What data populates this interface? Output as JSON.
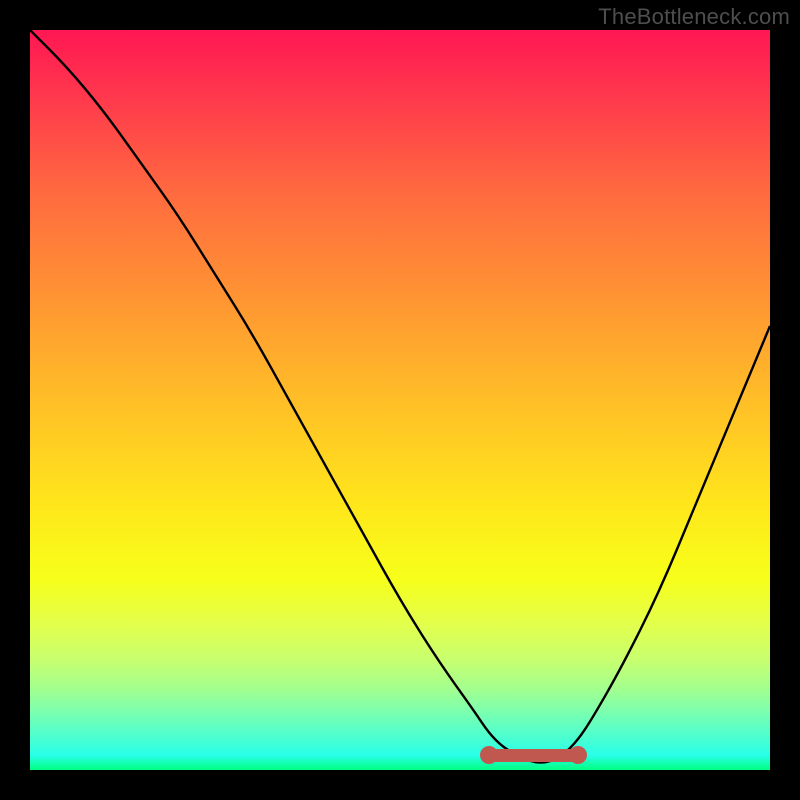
{
  "watermark": "TheBottleneck.com",
  "colors": {
    "frame_bg": "#000000",
    "curve_stroke": "#000000",
    "marker_fill": "#c1584f",
    "gradient_top": "#ff1753",
    "gradient_bottom": "#00ff80"
  },
  "chart_data": {
    "type": "line",
    "title": "",
    "xlabel": "",
    "ylabel": "",
    "xlim": [
      0,
      100
    ],
    "ylim": [
      0,
      100
    ],
    "x": [
      0,
      5,
      10,
      15,
      20,
      25,
      30,
      35,
      40,
      45,
      50,
      55,
      60,
      62,
      64,
      66,
      68,
      70,
      72,
      74,
      76,
      80,
      85,
      90,
      95,
      100
    ],
    "values": [
      100,
      95,
      89,
      82,
      75,
      67,
      59,
      50,
      41,
      32,
      23,
      15,
      8,
      5,
      3,
      2,
      1,
      1,
      2,
      4,
      7,
      14,
      24,
      36,
      48,
      60
    ],
    "trough": {
      "x_start": 62,
      "x_end": 74,
      "y": 2
    },
    "note": "Values are percentage heights read from the curve; x is normalized position across the plot width. No axes, ticks, legend, or title are rendered in the source image."
  }
}
